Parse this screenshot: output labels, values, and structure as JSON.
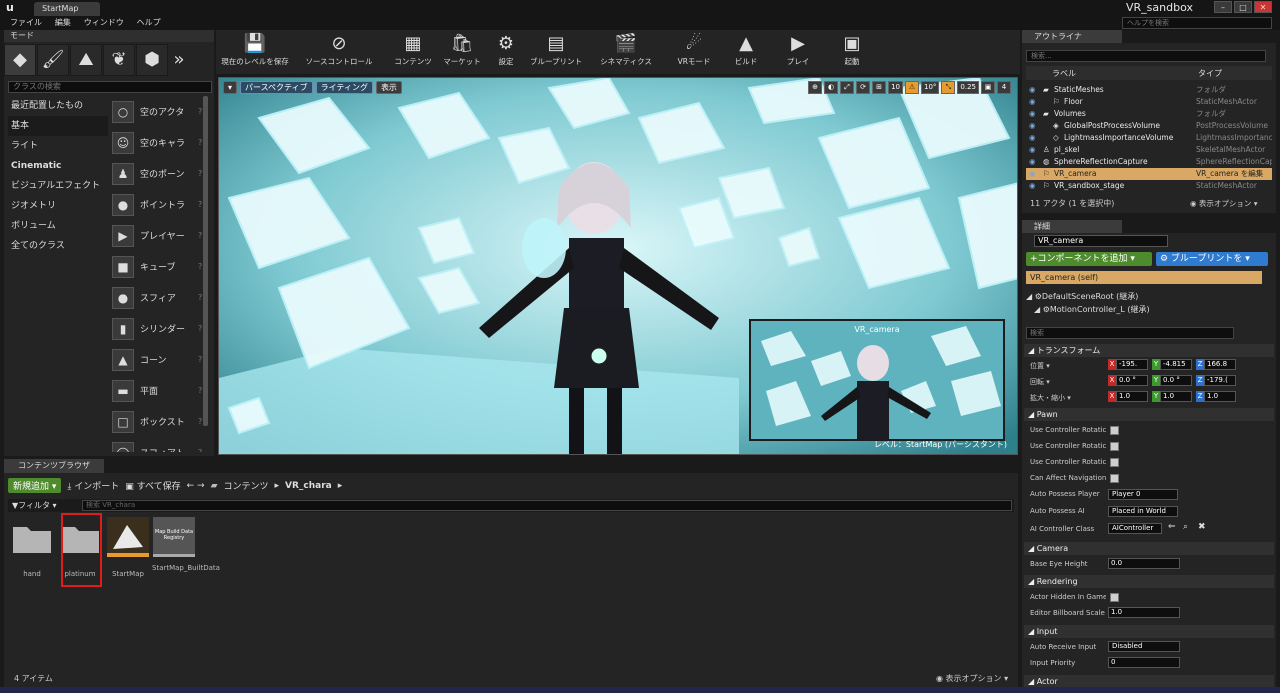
{
  "window": {
    "logo": "u",
    "map_tab": "StartMap",
    "project": "VR_sandbox",
    "help_search_placeholder": "ヘルプを検索",
    "min": "–",
    "max": "□",
    "close": "✕"
  },
  "menu": [
    "ファイル",
    "編集",
    "ウィンドウ",
    "ヘルプ"
  ],
  "modes": {
    "tab": "モード",
    "search_placeholder": "クラスの検索",
    "categories": [
      "最近配置したもの",
      "基本",
      "ライト",
      "Cinematic",
      "ビジュアルエフェクト",
      "ジオメトリ",
      "ボリューム",
      "全てのクラス"
    ],
    "items": [
      {
        "label": "空のアクタ",
        "icon": "○"
      },
      {
        "label": "空のキャラ",
        "icon": "☺"
      },
      {
        "label": "空のポーン",
        "icon": "♟"
      },
      {
        "label": "ポイントラ",
        "icon": "●"
      },
      {
        "label": "プレイヤー",
        "icon": "▶"
      },
      {
        "label": "キューブ",
        "icon": "■"
      },
      {
        "label": "スフィア",
        "icon": "●"
      },
      {
        "label": "シリンダー",
        "icon": "▮"
      },
      {
        "label": "コーン",
        "icon": "▲"
      },
      {
        "label": "平面",
        "icon": "▬"
      },
      {
        "label": "ボックスト",
        "icon": "□"
      },
      {
        "label": "スフィアト",
        "icon": "◯"
      }
    ],
    "help": "?"
  },
  "toolbar": [
    {
      "label": "現在のレベルを保存",
      "icon": "💾"
    },
    {
      "label": "ソースコントロール",
      "icon": "⊘"
    },
    {
      "label": "コンテンツ",
      "icon": "▦"
    },
    {
      "label": "マーケット",
      "icon": "🛍"
    },
    {
      "label": "設定",
      "icon": "⚙"
    },
    {
      "label": "ブループリント",
      "icon": "▤"
    },
    {
      "label": "シネマティクス",
      "icon": "🎬"
    },
    {
      "label": "VRモード",
      "icon": "☄"
    },
    {
      "label": "ビルド",
      "icon": "▲"
    },
    {
      "label": "プレイ",
      "icon": "▶"
    },
    {
      "label": "起動",
      "icon": "▣"
    }
  ],
  "viewport": {
    "view_menu": "▾",
    "perspective": "パースペクティブ",
    "lighting": "ライティング",
    "show": "表示",
    "right_icons": [
      "⊕",
      "◐",
      "⤢",
      "⟳",
      "⊞",
      "10",
      "⚠",
      "10°",
      "⤡",
      "0.25",
      "▣",
      "4"
    ],
    "pip_title": "VR_camera",
    "level_label": "レベル：StartMap (パーシスタント)"
  },
  "content_browser": {
    "tab": "コンテンツブラウザ",
    "add_new": "新規追加 ▾",
    "import": "⤓ インポート",
    "save_all": "▣ すべて保存",
    "nav": "← →",
    "path_root": "コンテンツ",
    "path_sep": "▸",
    "path_folder": "VR_chara",
    "path_end": "▸",
    "filter": "▼フィルタ ▾",
    "search_placeholder": "検索 VR_chara",
    "assets": [
      {
        "label": "hand",
        "kind": "folder"
      },
      {
        "label": "platinum",
        "kind": "folder"
      },
      {
        "label": "StartMap",
        "kind": "map"
      },
      {
        "label": "StartMap_BuiltData",
        "kind": "data",
        "thumb_text": "Map Build Data Registry"
      }
    ],
    "count": "4 アイテム",
    "view_options": "◉ 表示オプション ▾"
  },
  "outliner": {
    "tab": "アウトライナ",
    "search_placeholder": "検索...",
    "col_label": "ラベル",
    "col_type": "タイプ",
    "rows": [
      {
        "label": "StaticMeshes",
        "type": "フォルダ",
        "indent": 1,
        "icon": "▰"
      },
      {
        "label": "Floor",
        "type": "StaticMeshActor",
        "indent": 2,
        "icon": "⚐"
      },
      {
        "label": "Volumes",
        "type": "フォルダ",
        "indent": 1,
        "icon": "▰"
      },
      {
        "label": "GlobalPostProcessVolume",
        "type": "PostProcessVolume",
        "indent": 2,
        "icon": "◈"
      },
      {
        "label": "LightmassImportanceVolume",
        "type": "LightmassImportanceVolume",
        "indent": 2,
        "icon": "◇"
      },
      {
        "label": "pl_skel",
        "type": "SkeletalMeshActor",
        "indent": 1,
        "icon": "♙"
      },
      {
        "label": "SphereReflectionCapture",
        "type": "SphereReflectionCapture",
        "indent": 1,
        "icon": "◍"
      },
      {
        "label": "VR_camera",
        "type": "VR_camera を編集",
        "indent": 1,
        "icon": "⚐",
        "selected": true
      },
      {
        "label": "VR_sandbox_stage",
        "type": "StaticMeshActor",
        "indent": 1,
        "icon": "⚐"
      }
    ],
    "status": "11 アクタ (1 を選択中)",
    "view_options": "◉ 表示オプション ▾"
  },
  "details": {
    "tab": "詳細",
    "actor_name": "VR_camera",
    "add_component": "+コンポーネントを追加 ▾",
    "blueprint": "⚙ ブループリントを ▾",
    "self": "VR_camera (self)",
    "tree": [
      "◢ ⚙DefaultSceneRoot (継承)",
      "◢ ⚙MotionController_L (継承)"
    ],
    "search_placeholder": "検索",
    "transform": {
      "section": "◢ トランスフォーム",
      "location": {
        "label": "位置 ▾",
        "x": "-195.",
        "y": "-4.815",
        "z": "166.8"
      },
      "rotation": {
        "label": "回転 ▾",
        "x": "0.0 °",
        "y": "0.0 °",
        "z": "-179.("
      },
      "scale": {
        "label": "拡大・縮小 ▾",
        "x": "1.0",
        "y": "1.0",
        "z": "1.0"
      }
    },
    "pawn": {
      "section": "◢ Pawn",
      "c1": "Use Controller Rotatic",
      "c2": "Use Controller Rotatic",
      "c3": "Use Controller Rotatic",
      "c4": "Can Affect Navigation",
      "possess_player_label": "Auto Possess Player",
      "possess_player": "Player 0",
      "possess_ai_label": "Auto Possess AI",
      "possess_ai": "Placed in World",
      "ai_class_label": "AI Controller Class",
      "ai_class": "AIController"
    },
    "camera": {
      "section": "◢ Camera",
      "eye_label": "Base Eye Height",
      "eye": "0.0"
    },
    "rendering": {
      "section": "◢ Rendering",
      "hidden_label": "Actor Hidden In Game",
      "billboard_label": "Editor Billboard Scale",
      "billboard": "1.0"
    },
    "input": {
      "section": "◢ Input",
      "receive_label": "Auto Receive Input",
      "receive": "Disabled",
      "priority_label": "Input Priority",
      "priority": "0"
    },
    "actor": {
      "section": "◢ Actor"
    }
  },
  "colors": {
    "accent_green": "#4d8b2c",
    "accent_blue": "#2f7bd0",
    "selection": "#d8a864",
    "highlight_box": "#e01b1b"
  }
}
